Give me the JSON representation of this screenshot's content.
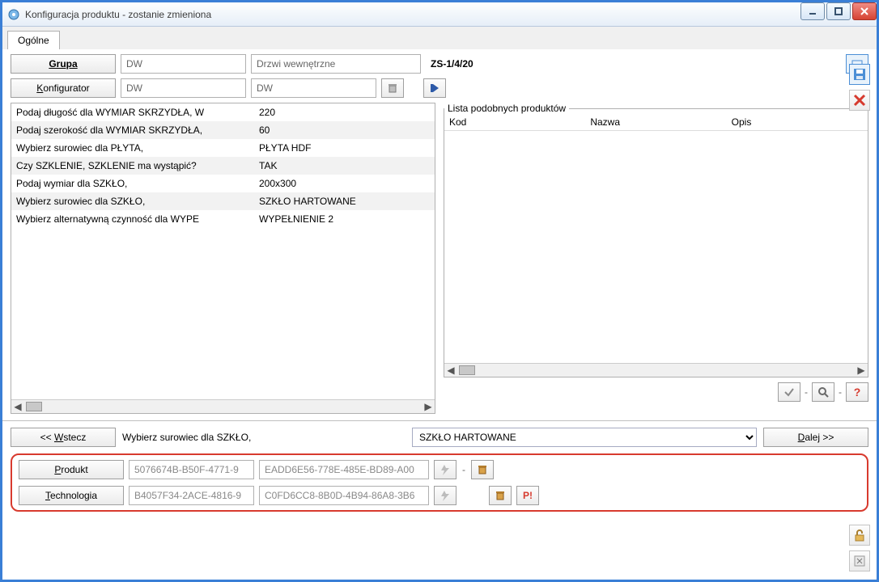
{
  "window": {
    "title": "Konfiguracja produktu - zostanie zmieniona"
  },
  "tab": {
    "general": "Ogólne"
  },
  "header": {
    "group_btn": "Grupa",
    "group_code": "DW",
    "group_name": "Drzwi wewnętrzne",
    "doc_code": "ZS-1/4/20",
    "config_btn": "Konfigurator",
    "config_code": "DW",
    "config_name": "DW"
  },
  "params": [
    {
      "label": "Podaj długość dla WYMIAR SKRZYDŁA, W",
      "value": "220"
    },
    {
      "label": "Podaj szerokość dla WYMIAR SKRZYDŁA,",
      "value": "60"
    },
    {
      "label": "Wybierz surowiec dla PŁYTA,",
      "value": "PŁYTA HDF"
    },
    {
      "label": "Czy SZKLENIE, SZKLENIE ma wystąpić?",
      "value": "TAK"
    },
    {
      "label": "Podaj wymiar dla SZKŁO,",
      "value": "200x300"
    },
    {
      "label": "Wybierz surowiec dla SZKŁO,",
      "value": "SZKŁO HARTOWANE"
    },
    {
      "label": "Wybierz alternatywną czynność dla WYPE",
      "value": "WYPEŁNIENIE 2"
    }
  ],
  "similar": {
    "legend": "Lista podobnych produktów",
    "cols": {
      "code": "Kod",
      "name": "Nazwa",
      "desc": "Opis"
    }
  },
  "footer": {
    "back": "<< Wstecz",
    "question": "Wybierz surowiec dla SZKŁO,",
    "answer": "SZKŁO HARTOWANE",
    "next": "Dalej >>"
  },
  "generated": {
    "product_btn": "Produkt",
    "product_id1": "5076674B-B50F-4771-9",
    "product_id2": "EADD6E56-778E-485E-BD89-A00",
    "tech_btn": "Technologia",
    "tech_id1": "B4057F34-2ACE-4816-9",
    "tech_id2": "C0FD6CC8-8B0D-4B94-86A8-3B6"
  }
}
